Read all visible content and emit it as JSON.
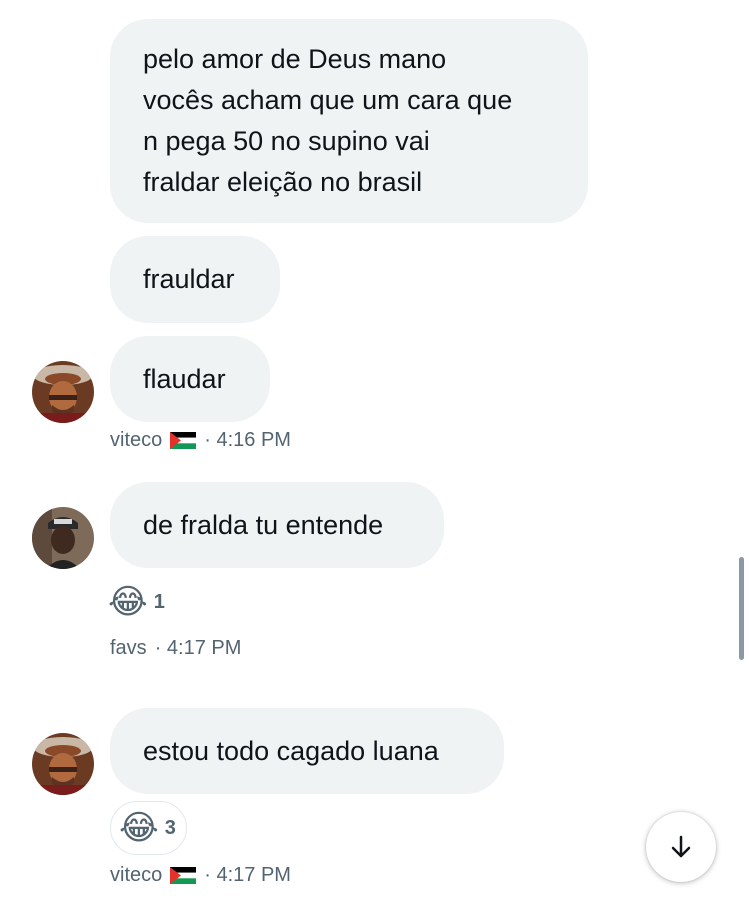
{
  "messages": [
    {
      "text": "pelo amor de Deus mano\nvocês acham que um cara que\nn pega 50 no supino vai\nfraldar eleição no brasil"
    },
    {
      "text": "frauldar"
    },
    {
      "text": "flaudar"
    },
    {
      "text": "de fralda tu entende"
    },
    {
      "text": "estou todo cagado luana"
    }
  ],
  "meta": [
    {
      "name": "viteco",
      "time": "· 4:16 PM"
    },
    {
      "name": "favs",
      "time": "· 4:17 PM"
    },
    {
      "name": "viteco",
      "time": "· 4:17 PM"
    }
  ],
  "reactions": [
    {
      "emoji": "😂",
      "count": "1"
    },
    {
      "emoji": "😂",
      "count": "3"
    }
  ],
  "icons": {
    "scroll_down": "arrow-down-icon",
    "flag": "palestine-flag-icon"
  },
  "colors": {
    "bubble": "#eff3f4",
    "meta_text": "#536471"
  }
}
